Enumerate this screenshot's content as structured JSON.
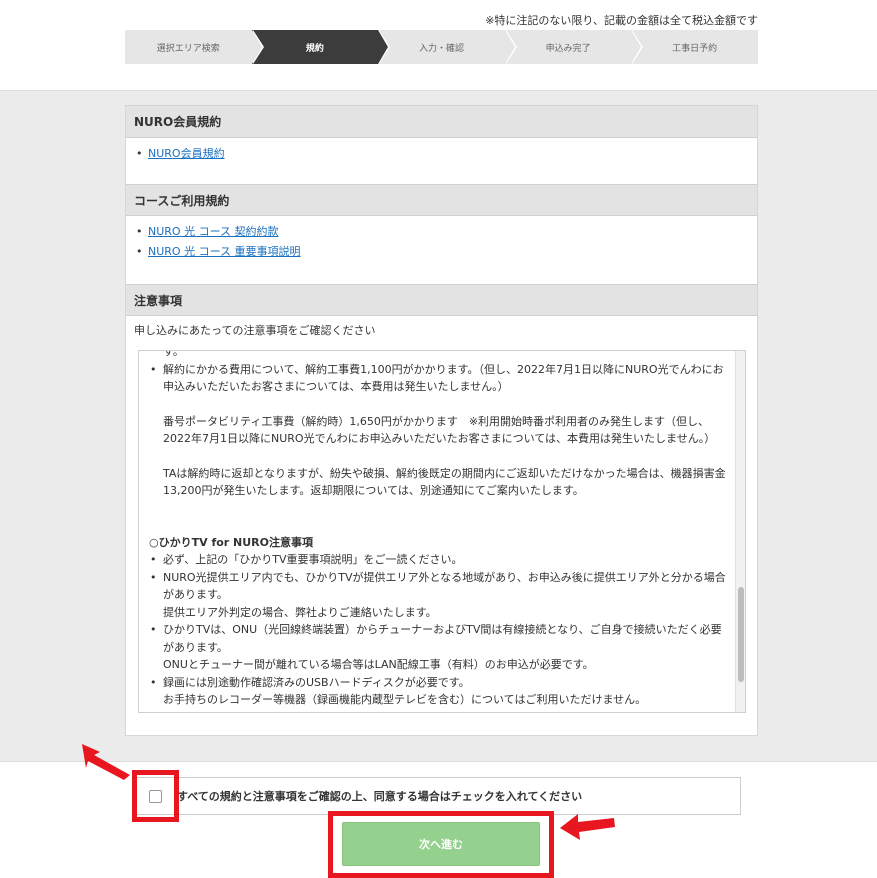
{
  "tax_note": "※特に注記のない限り、記載の金額は全て税込金額です",
  "steps": [
    {
      "label": "選択エリア検索",
      "active": false
    },
    {
      "label": "規約",
      "active": true
    },
    {
      "label": "入力・確認",
      "active": false
    },
    {
      "label": "申込み完了",
      "active": false
    },
    {
      "label": "工事日予約",
      "active": false
    }
  ],
  "sections": {
    "member": {
      "title": "NURO会員規約",
      "links": [
        "NURO会員規約"
      ]
    },
    "course": {
      "title": "コースご利用規約",
      "links": [
        "NURO 光 コース 契約約款",
        "NURO 光 コース 重要事項説明"
      ]
    },
    "notice": {
      "title": "注意事項",
      "intro": "申し込みにあたっての注意事項をご確認ください",
      "top_fragment": "す。",
      "bullet_cancel": "解約にかかる費用について、解約工事費1,100円がかかります。（但し、2022年7月1日以降にNURO光でんわにお申込みいただいたお客さまについては、本費用は発生いたしません。）",
      "para_portability": "番号ポータビリティ工事費（解約時）1,650円がかかります　※利用開始時番ポ利用者のみ発生します（但し、2022年7月1日以降にNURO光でんわにお申込みいただいたお客さまについては、本費用は発生いたしません。）",
      "para_ta": "TAは解約時に返却となりますが、紛失や破損、解約後既定の期間内にご返却いただけなかった場合は、機器損害金13,200円が発生いたします。返却期限については、別途通知にてご案内いたします。",
      "tv_heading": "○ひかりTV for NURO注意事項",
      "tv_b1": "必ず、上記の「ひかりTV重要事項説明」をご一読ください。",
      "tv_b2": "NURO光提供エリア内でも、ひかりTVが提供エリア外となる地域があり、お申込み後に提供エリア外と分かる場合があります。",
      "tv_b2_sub": "提供エリア外判定の場合、弊社よりご連絡いたします。",
      "tv_b3": "ひかりTVは、ONU（光回線終端装置）からチューナーおよびTV間は有線接続となり、ご自身で接続いただく必要があります。",
      "tv_b3_sub": "ONUとチューナー間が離れている場合等はLAN配線工事（有料）のお申込が必要です。",
      "tv_b4": "録画には別途動作確認済みのUSBハードディスクが必要です。",
      "tv_b4_sub": "お手持ちのレコーダー等機器（録画機能内蔵型テレビを含む）についてはご利用いただけません。"
    }
  },
  "agree": {
    "label": "すべての規約と注意事項をご確認の上、同意する場合はチェックを入れてください",
    "checked": false
  },
  "next_button": "次へ進む",
  "colors": {
    "highlight_red": "#e8161e",
    "button_green": "#95d18e",
    "active_step": "#3c3c3c",
    "link_blue": "#1a6fc0"
  }
}
